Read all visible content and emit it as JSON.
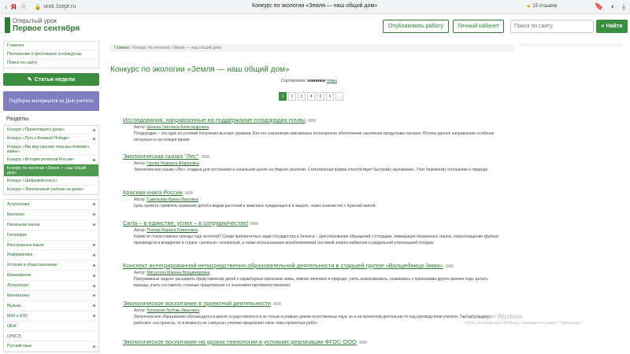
{
  "browser": {
    "url": "urok.1sept.ru",
    "tab_title": "Конкурс по экологии «Земля — наш общий дом»",
    "reviews": "15 отзывов"
  },
  "header": {
    "logo_line1": "Открытый урок",
    "logo_line2": "Первое сентября",
    "publish_btn": "Опубликовать работу",
    "cabinet_btn": "Личный кабинет",
    "search_placeholder": "Поиск по сайту",
    "search_btn": "Найти"
  },
  "sidebar": {
    "links": [
      "Главная",
      "Положение о фестивале и конкурсах",
      "Поиск по сайту"
    ],
    "articles_btn": "Статьи недели",
    "promo_btn": "Подборка материалов ко Дню учителя",
    "sections_title": "Разделы",
    "sections": [
      "Конкурс «Презентация к уроку»",
      "Конкурс «Путь к Великой Победе»",
      "Конкурс «Мы мир храним, пока мы помним о войне»",
      "Конкурс «История регионов России»",
      "Конкурс по экологии «Земля — наш общий дом»",
      "Конкурс «Цифровой класс»",
      "Конкурс «Электронный учебник на уроке»"
    ],
    "subjects": [
      "Астрономия",
      "Биология",
      "Начальная школа",
      "География",
      "Иностранные языки",
      "Информатика",
      "История и обществознание",
      "Краеведение",
      "Литература",
      "Математика",
      "Музыка",
      "МХК и ИЗО",
      "ОБЖ",
      "ОРКСЭ",
      "Русский язык"
    ]
  },
  "main": {
    "breadcrumb_home": "Главная",
    "breadcrumb_sep": "/",
    "breadcrumb_current": "Конкурс по экологии «Земля — наш общий дом»",
    "title": "Конкурс по экологии «Земля — наш общий дом»",
    "sort_label": "Сортировка:",
    "sort_new": "новинки",
    "sort_topics": "темы",
    "pages": [
      "1",
      "2",
      "3",
      "4",
      "5",
      "6",
      "→"
    ],
    "author_label": "Автор:",
    "articles": [
      {
        "title": "Исследования, направленные на поддержание плодородия почвы",
        "author": "Шагина Светлана Александровна",
        "desc": "Плодородие – это одно из условий получения высоких урожаев. Без его сохранения невозможно полноценное обеспечение населения продуктами питания. Потому данное направление особенно актуально в настоящее время."
      },
      {
        "title": "Экологическая сказка \"Лес\"",
        "author": "Гурова Людмила Фёдоровна",
        "desc": "Экологическая сказка «Лес» создана для постановки в начальной школе на Неделе экологии. Стихотворная форма способствует быстрому заучиванию. Учит бережному отношению к природе."
      },
      {
        "title": "Красная книга России",
        "author": "Савельева Ирина Ивановна",
        "desc": "Цель проекта: привлечь внимание детей к видам растений и животных нуждающихся в защите ,через знакомство с Красной книгой."
      },
      {
        "title": "Сила – в единстве, успех – в сотрудничестве!",
        "author": "Попова Марина Семеновна",
        "desc": "Каким не стали главные тренды года экологии? Среди приоритетных задач государства и бизнеса – урегулирование обращений с отходами, ликвидация незаконных свалок, переоснащение крупных производств и внедрение в стране «зелёных» технологий, а также использование возобновляемой системой энергоснабжения и раздельной утилизацией отходов."
      },
      {
        "title": "Конспект интегрированной непосредственно образовательной деятельности в старшей группе «Волшебница Зима»",
        "author": "Мигунская Марина Владимировна",
        "desc": "Программные задачи: расширять представления детей о характерных признаках зимы, зимних явлениях в природе; учить анализировать, сравнивать с признаками других времен года, делать выводы, учить составлять сложные предложения со значением противопоставления."
      },
      {
        "title": "Экологическое воспитание в проектной деятельности",
        "author": "Кулешова Любовь Ивановна",
        "desc": "Экологическое образование обучающихся в школе осуществляется в не только в рамках уроков естественных наук, но и на проектной деятельности под руководством учителя. Так как учащиеся работают «на проекты, то в моменту их «запуска» ученики предлагают свою темы проектных работ."
      },
      {
        "title": "Экологическое воспитание на уроках технологии в условиях реализации ФГОС ООО",
        "author": "",
        "desc": ""
      }
    ]
  },
  "watermark": {
    "line1": "Активация Windows",
    "line2": "Чтобы активировать Windows, перейдите в раздел \"Параметры\"."
  }
}
